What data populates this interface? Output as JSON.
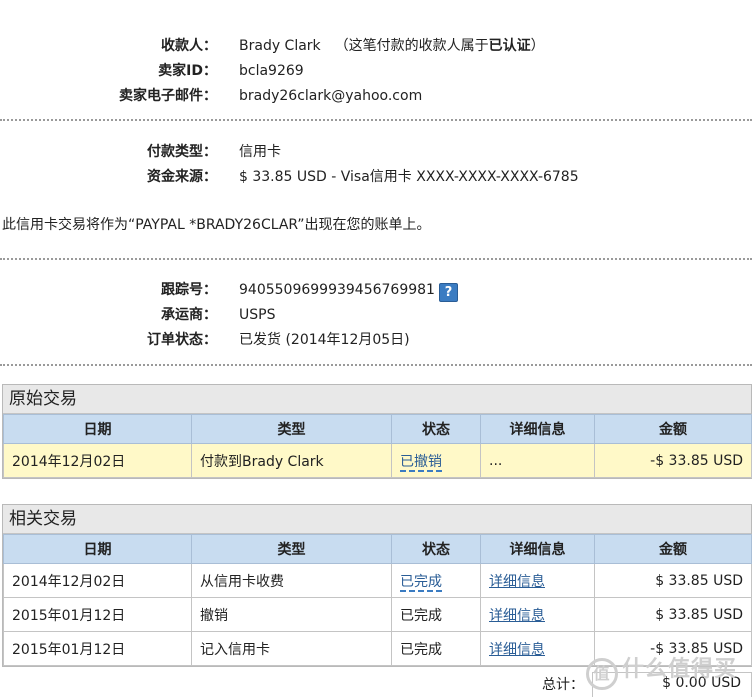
{
  "payee": {
    "label": "收款人：",
    "name": "Brady Clark",
    "note_prefix": "（这笔付款的收款人属于",
    "note_bold": "已认证",
    "note_suffix": "）"
  },
  "seller_id": {
    "label": "卖家ID：",
    "value": "bcla9269"
  },
  "seller_email": {
    "label": "卖家电子邮件：",
    "value": "brady26clark@yahoo.com"
  },
  "payment_type": {
    "label": "付款类型：",
    "value": "信用卡"
  },
  "funding_source": {
    "label": "资金来源：",
    "value": "$ 33.85 USD - Visa信用卡 XXXX-XXXX-XXXX-6785"
  },
  "statement_text": "此信用卡交易将作为“PAYPAL *BRADY26CLAR”出现在您的账单上。",
  "tracking": {
    "label": "跟踪号：",
    "value": "9405509699939456769981",
    "help": "?"
  },
  "carrier": {
    "label": "承运商：",
    "value": "USPS"
  },
  "order_status": {
    "label": "订单状态：",
    "value": "已发货 (2014年12月05日)"
  },
  "original": {
    "title": "原始交易",
    "headers": [
      "日期",
      "类型",
      "状态",
      "详细信息",
      "金额"
    ],
    "rows": [
      {
        "date": "2014年12月02日",
        "type": "付款到Brady Clark",
        "status": "已撤销",
        "details": "...",
        "amount": "-$ 33.85 USD"
      }
    ]
  },
  "related": {
    "title": "相关交易",
    "headers": [
      "日期",
      "类型",
      "状态",
      "详细信息",
      "金额"
    ],
    "rows": [
      {
        "date": "2014年12月02日",
        "type": "从信用卡收费",
        "status": "已完成",
        "details": "详细信息",
        "amount": "$ 33.85 USD"
      },
      {
        "date": "2015年01月12日",
        "type": "撤销",
        "status": "已完成",
        "details": "详细信息",
        "amount": "$ 33.85 USD"
      },
      {
        "date": "2015年01月12日",
        "type": "记入信用卡",
        "status": "已完成",
        "details": "详细信息",
        "amount": "-$ 33.85 USD"
      }
    ],
    "total_label": "总计：",
    "total_value": "$ 0.00 USD"
  },
  "watermark": {
    "badge": "值",
    "text": "什么值得买"
  }
}
